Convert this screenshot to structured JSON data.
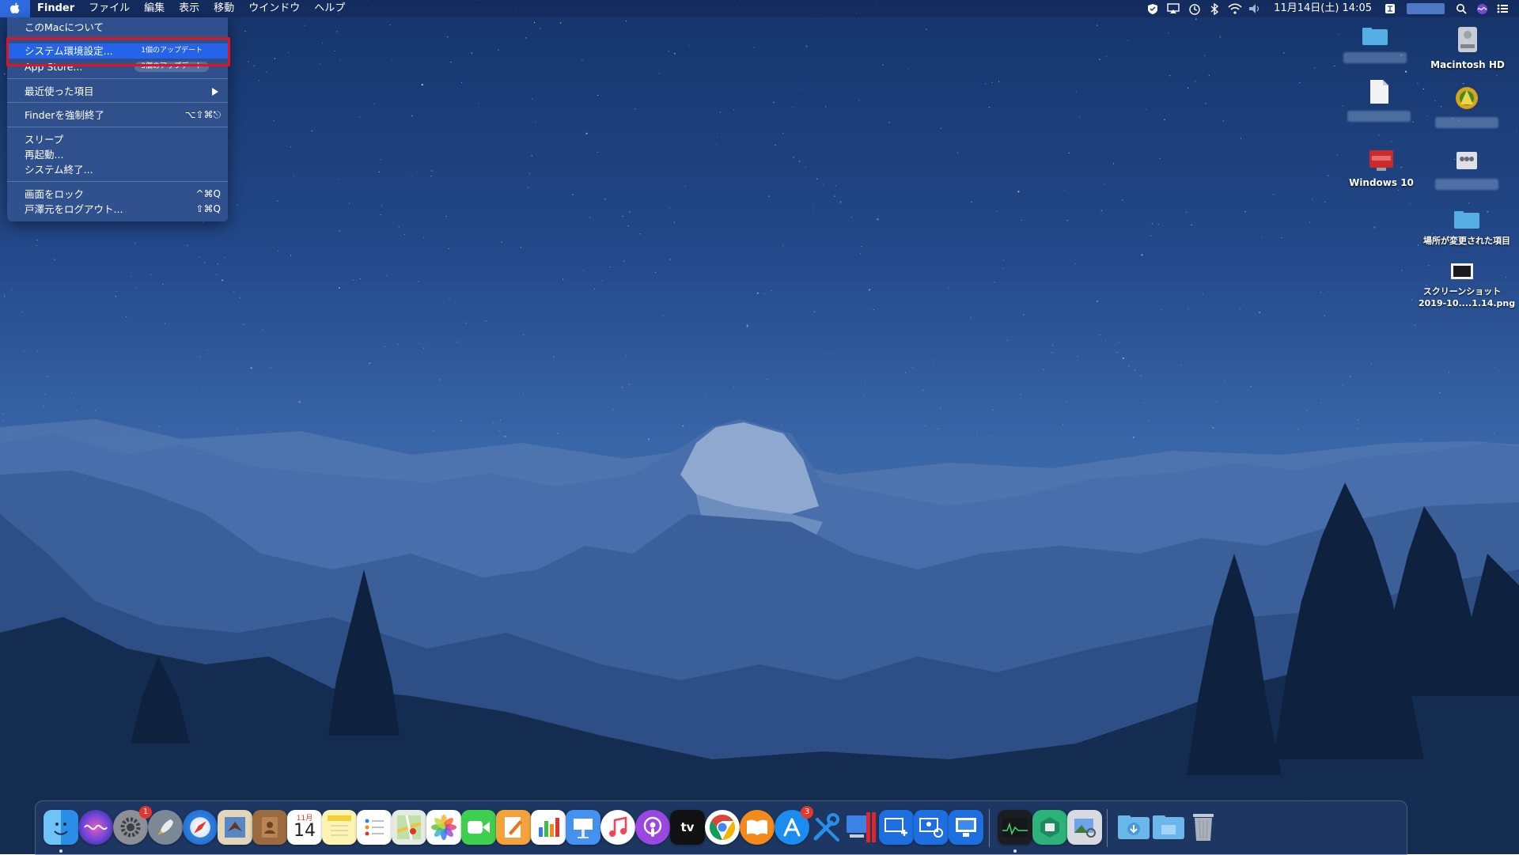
{
  "menubar": {
    "apple_icon": "apple-logo-icon",
    "app_name": "Finder",
    "menus": [
      "ファイル",
      "編集",
      "表示",
      "移動",
      "ウインドウ",
      "ヘルプ"
    ],
    "clock": "11月14日(土) 14:05",
    "status_icons": [
      "security-shield-icon",
      "airplay-icon",
      "time-machine-icon",
      "bluetooth-icon",
      "wifi-icon",
      "volume-icon"
    ]
  },
  "apple_menu": {
    "about": "このMacについて",
    "system_prefs": "システム環境設定...",
    "system_prefs_badge": "1個のアップデート",
    "app_store": "App Store...",
    "app_store_badge": "3個のアップデート",
    "recent_items": "最近使った項目",
    "force_quit": "Finderを強制終了",
    "force_quit_shortcut": "⌥⇧⌘⎋",
    "sleep": "スリープ",
    "restart": "再起動...",
    "shutdown": "システム終了...",
    "lock_screen": "画面をロック",
    "lock_screen_shortcut": "^⌘Q",
    "logout": "戸澤元をログアウト...",
    "logout_shortcut": "⇧⌘Q"
  },
  "desktop_icons": {
    "macintosh_hd": "Macintosh HD",
    "windows10": "Windows 10",
    "relocated_items": "場所が変更された項目",
    "screenshot_line1": "スクリーンショット",
    "screenshot_line2": "2019-10....1.14.png"
  },
  "dock": {
    "calendar_month": "11月",
    "calendar_day": "14",
    "system_prefs_badge": "1",
    "app_store_badge": "3",
    "tv_label": "tv"
  },
  "colors": {
    "highlight": "#2563e8",
    "annotation": "#e6121b"
  }
}
